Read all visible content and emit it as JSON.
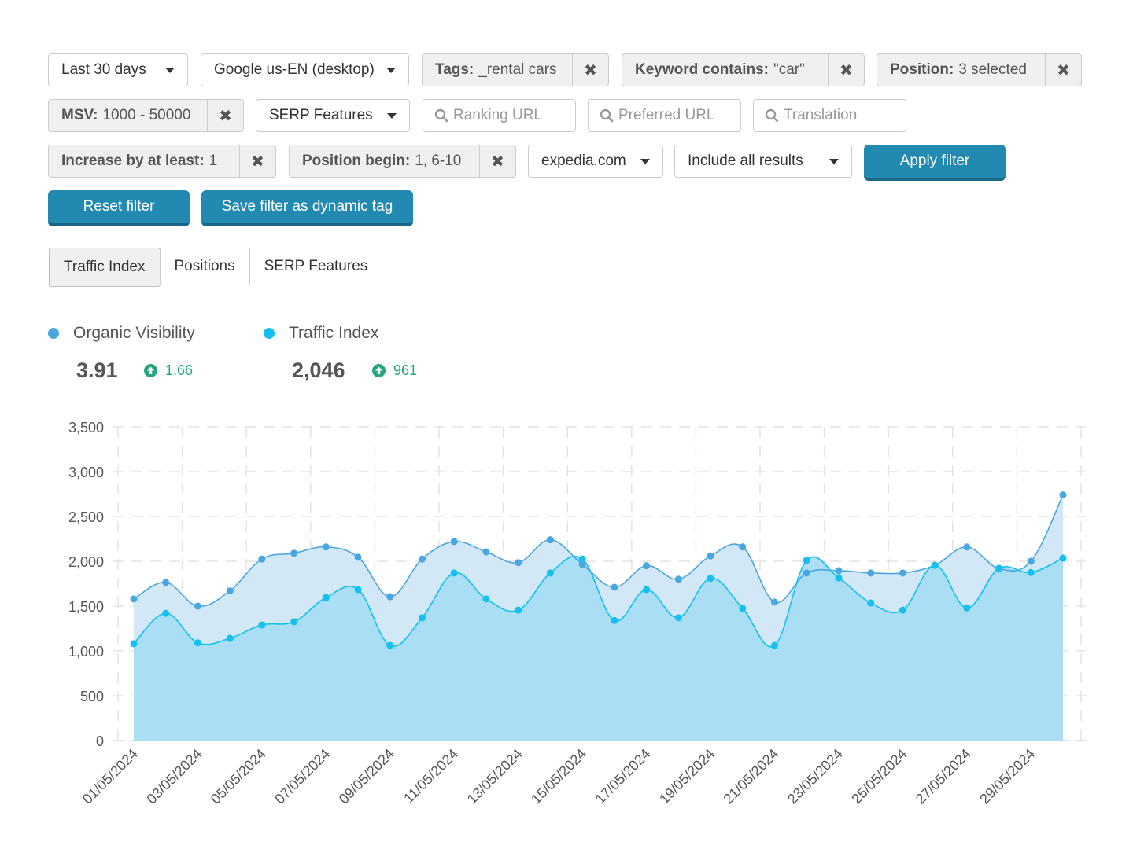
{
  "filters": {
    "row1": {
      "date_range": "Last 30 days",
      "search_engine": "Google us-EN (desktop)",
      "tags": {
        "key": "Tags:",
        "value": "_rental cars"
      },
      "keyword": {
        "key": "Keyword contains:",
        "value": "\"car\""
      },
      "position": {
        "key": "Position:",
        "value": "3 selected"
      }
    },
    "row2": {
      "msv": {
        "key": "MSV:",
        "value": "1000 - 50000"
      },
      "serp_features": "SERP Features",
      "ranking_url_placeholder": "Ranking URL",
      "preferred_url_placeholder": "Preferred URL",
      "translation_placeholder": "Translation"
    },
    "row3": {
      "increase": {
        "key": "Increase by at least:",
        "value": "1"
      },
      "position_begin": {
        "key": "Position begin:",
        "value": "1, 6-10"
      },
      "domain": "expedia.com",
      "results": "Include all results",
      "apply_label": "Apply filter"
    },
    "reset_label": "Reset filter",
    "save_label": "Save filter as dynamic tag",
    "remove_glyph": "✖"
  },
  "tabs": [
    {
      "label": "Traffic Index",
      "active": true
    },
    {
      "label": "Positions",
      "active": false
    },
    {
      "label": "SERP Features",
      "active": false
    }
  ],
  "metrics": [
    {
      "label": "Organic Visibility",
      "value": "3.91",
      "delta": "1.66",
      "color": "#4aa6e0"
    },
    {
      "label": "Traffic Index",
      "value": "2,046",
      "delta": "961",
      "color": "#13c0ee"
    }
  ],
  "colors": {
    "accent": "#2289b0",
    "positive": "#27a57f"
  },
  "chart_data": {
    "type": "area",
    "title": "",
    "xlabel": "",
    "ylabel": "",
    "ylim": [
      0,
      3500
    ],
    "yticks": [
      0,
      500,
      1000,
      1500,
      2000,
      2500,
      3000,
      3500
    ],
    "ytick_labels": [
      "0",
      "500",
      "1,000",
      "1,500",
      "2,000",
      "2,500",
      "3,000",
      "3,500"
    ],
    "grid": true,
    "legend_position": "top-left",
    "x": [
      "01/05/2024",
      "02/05/2024",
      "03/05/2024",
      "04/05/2024",
      "05/05/2024",
      "06/05/2024",
      "07/05/2024",
      "08/05/2024",
      "09/05/2024",
      "10/05/2024",
      "11/05/2024",
      "12/05/2024",
      "13/05/2024",
      "14/05/2024",
      "15/05/2024",
      "16/05/2024",
      "17/05/2024",
      "18/05/2024",
      "19/05/2024",
      "20/05/2024",
      "21/05/2024",
      "22/05/2024",
      "23/05/2024",
      "24/05/2024",
      "25/05/2024",
      "26/05/2024",
      "27/05/2024",
      "28/05/2024",
      "29/05/2024",
      "30/05/2024"
    ],
    "xtick_labels": [
      "01/05/2024",
      "03/05/2024",
      "05/05/2024",
      "07/05/2024",
      "09/05/2024",
      "11/05/2024",
      "13/05/2024",
      "15/05/2024",
      "17/05/2024",
      "19/05/2024",
      "21/05/2024",
      "23/05/2024",
      "25/05/2024",
      "27/05/2024",
      "29/05/2024"
    ],
    "series": [
      {
        "name": "Organic Visibility",
        "color": "#4aa6e0",
        "fill": "#d0e7f6",
        "values": [
          1580,
          1765,
          1500,
          1670,
          2025,
          2090,
          2160,
          2045,
          1605,
          2025,
          2220,
          2105,
          1985,
          2240,
          1965,
          1710,
          1950,
          1800,
          2060,
          2160,
          1545,
          1870,
          1895,
          1870,
          1870,
          1955,
          2160,
          1920,
          2000,
          2740
        ]
      },
      {
        "name": "Traffic Index",
        "color": "#13c0ee",
        "fill": "#a8ddf4",
        "values": [
          1080,
          1420,
          1090,
          1140,
          1290,
          1325,
          1595,
          1685,
          1060,
          1370,
          1870,
          1580,
          1455,
          1870,
          2025,
          1340,
          1685,
          1370,
          1810,
          1475,
          1060,
          2010,
          1815,
          1535,
          1455,
          1955,
          1480,
          1920,
          1875,
          2035
        ]
      }
    ]
  }
}
